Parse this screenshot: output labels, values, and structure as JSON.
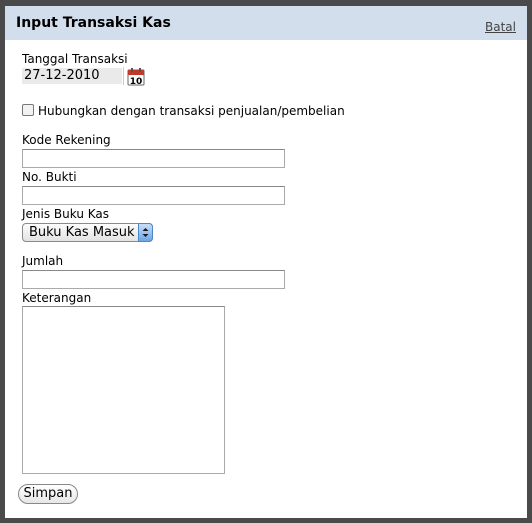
{
  "dialog": {
    "title": "Input Transaksi Kas",
    "cancel_label": "Batal"
  },
  "form": {
    "date": {
      "label": "Tanggal Transaksi",
      "value": "27-12-2010",
      "icon": "calendar-icon",
      "icon_day": "10"
    },
    "link_checkbox": {
      "label": "Hubungkan dengan transaksi penjualan/pembelian",
      "checked": false
    },
    "account_code": {
      "label": "Kode Rekening",
      "value": ""
    },
    "proof_no": {
      "label": "No. Bukti",
      "value": ""
    },
    "cashbook_type": {
      "label": "Jenis Buku Kas",
      "selected": "Buku Kas Masuk"
    },
    "amount": {
      "label": "Jumlah",
      "value": ""
    },
    "notes": {
      "label": "Keterangan",
      "value": ""
    },
    "submit_label": "Simpan"
  }
}
